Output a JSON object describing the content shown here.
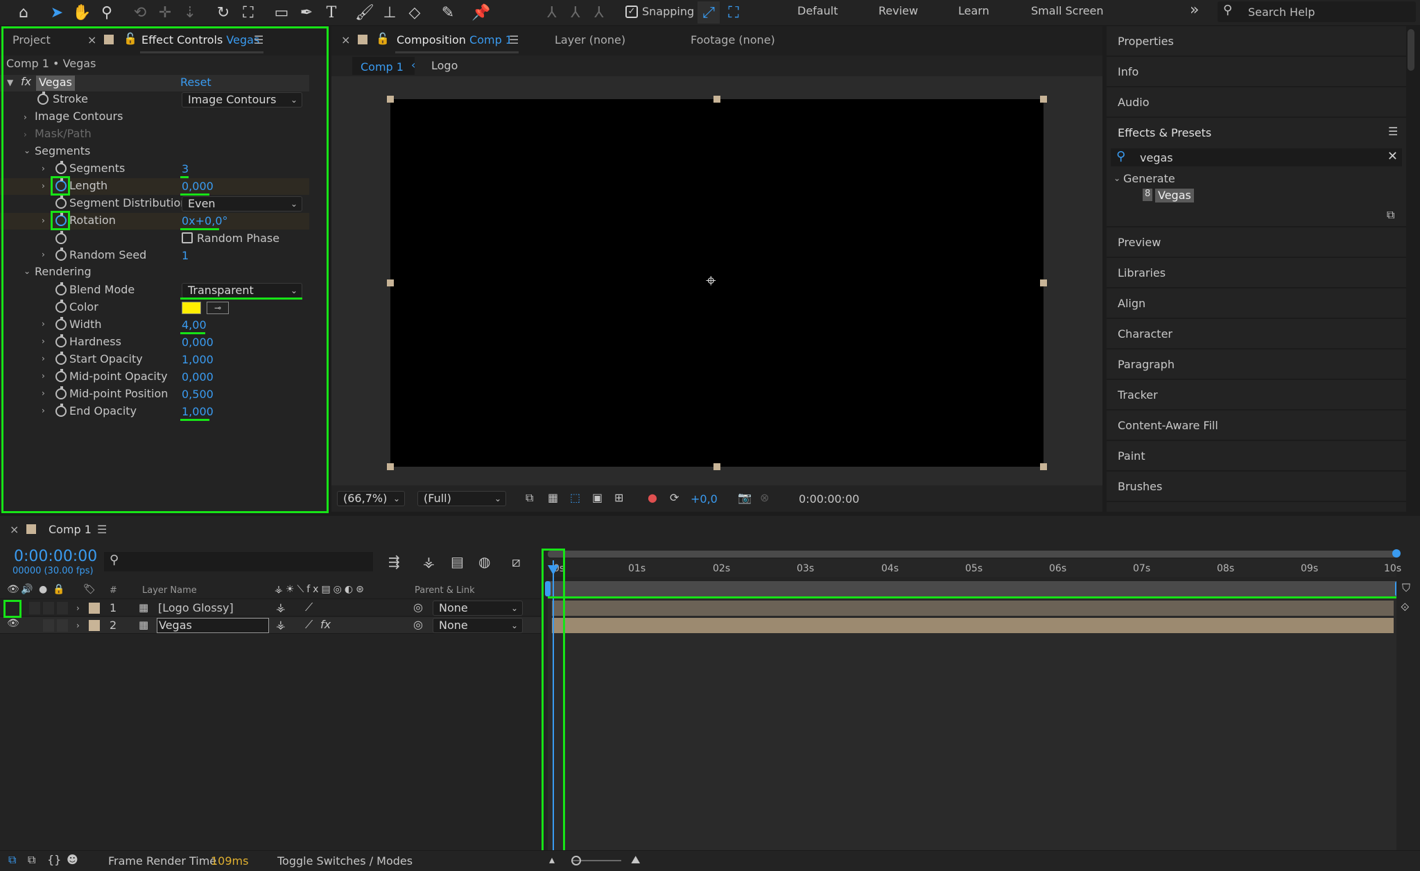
{
  "toolbar": {
    "snapping": "Snapping",
    "workspaces": [
      "Default",
      "Review",
      "Learn",
      "Small Screen"
    ],
    "search_placeholder": "Search Help"
  },
  "effect_controls": {
    "tab_project": "Project",
    "tab_title": "Effect Controls",
    "tab_layer": "Vegas",
    "breadcrumb": "Comp 1 • Vegas",
    "effect_name": "Vegas",
    "reset": "Reset",
    "stroke_label": "Stroke",
    "stroke_value": "Image Contours",
    "image_contours": "Image Contours",
    "mask_path": "Mask/Path",
    "segments_group": "Segments",
    "segments_label": "Segments",
    "segments_value": "3",
    "length_label": "Length",
    "length_value": "0,000",
    "seg_dist_label": "Segment Distribution",
    "seg_dist_value": "Even",
    "rotation_label": "Rotation",
    "rotation_value": "0x+0,0°",
    "random_phase": "Random Phase",
    "random_seed_label": "Random Seed",
    "random_seed_value": "1",
    "rendering_group": "Rendering",
    "blend_mode_label": "Blend Mode",
    "blend_mode_value": "Transparent",
    "color_label": "Color",
    "color_value": "#ffee00",
    "width_label": "Width",
    "width_value": "4,00",
    "hardness_label": "Hardness",
    "hardness_value": "0,000",
    "start_opacity_label": "Start Opacity",
    "start_opacity_value": "1,000",
    "mid_opacity_label": "Mid-point Opacity",
    "mid_opacity_value": "0,000",
    "mid_position_label": "Mid-point Position",
    "mid_position_value": "0,500",
    "end_opacity_label": "End Opacity",
    "end_opacity_value": "1,000"
  },
  "composition": {
    "tab_title": "Composition",
    "tab_comp": "Comp 1",
    "layer_tab": "Layer (none)",
    "footage_tab": "Footage (none)",
    "crumb_comp": "Comp 1",
    "crumb_logo": "Logo",
    "zoom": "(66,7%)",
    "resolution": "(Full)",
    "exposure": "+0,0",
    "timecode": "0:00:00:00"
  },
  "right_panels": {
    "top": [
      "Properties",
      "Info",
      "Audio"
    ],
    "effects_presets": "Effects & Presets",
    "search_value": "vegas",
    "category": "Generate",
    "result": "Vegas",
    "bottom": [
      "Preview",
      "Libraries",
      "Align",
      "Character",
      "Paragraph",
      "Tracker",
      "Content-Aware Fill",
      "Paint",
      "Brushes"
    ]
  },
  "timeline": {
    "tab": "Comp 1",
    "timecode": "0:00:00:00",
    "frames": "00000 (30.00 fps)",
    "col_num": "#",
    "col_layer_name": "Layer Name",
    "col_parent": "Parent & Link",
    "layers": [
      {
        "num": "1",
        "name": "[Logo Glossy]",
        "parent": "None"
      },
      {
        "num": "2",
        "name": "Vegas",
        "parent": "None"
      }
    ],
    "ticks": [
      "0s",
      "01s",
      "02s",
      "03s",
      "04s",
      "05s",
      "06s",
      "07s",
      "08s",
      "09s",
      "10s"
    ],
    "frame_render_label": "Frame Render Time",
    "frame_render_value": "109ms",
    "toggle": "Toggle Switches / Modes"
  }
}
